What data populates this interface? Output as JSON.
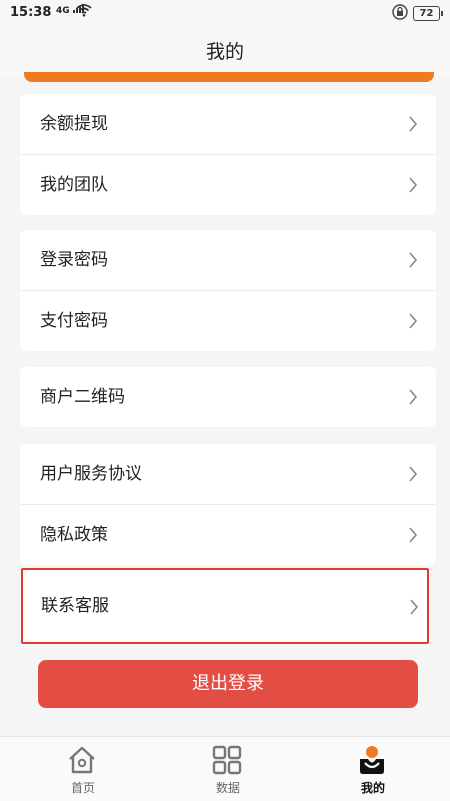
{
  "status": {
    "time": "15:38",
    "network": "4G",
    "battery": "72"
  },
  "nav": {
    "title": "我的"
  },
  "colors": {
    "accent": "#f07a22",
    "logout": "#e24d44",
    "highlight": "#e53935"
  },
  "menu": {
    "group1": [
      "余额提现",
      "我的团队"
    ],
    "group2": [
      "登录密码",
      "支付密码"
    ],
    "group3": [
      "商户二维码"
    ],
    "group4": [
      "用户服务协议",
      "隐私政策"
    ],
    "group5": [
      "联系客服"
    ]
  },
  "logout_label": "退出登录",
  "tabs": [
    {
      "label": "首页",
      "icon": "home-icon",
      "active": false
    },
    {
      "label": "数据",
      "icon": "grid-icon",
      "active": false
    },
    {
      "label": "我的",
      "icon": "user-icon",
      "active": true
    }
  ]
}
